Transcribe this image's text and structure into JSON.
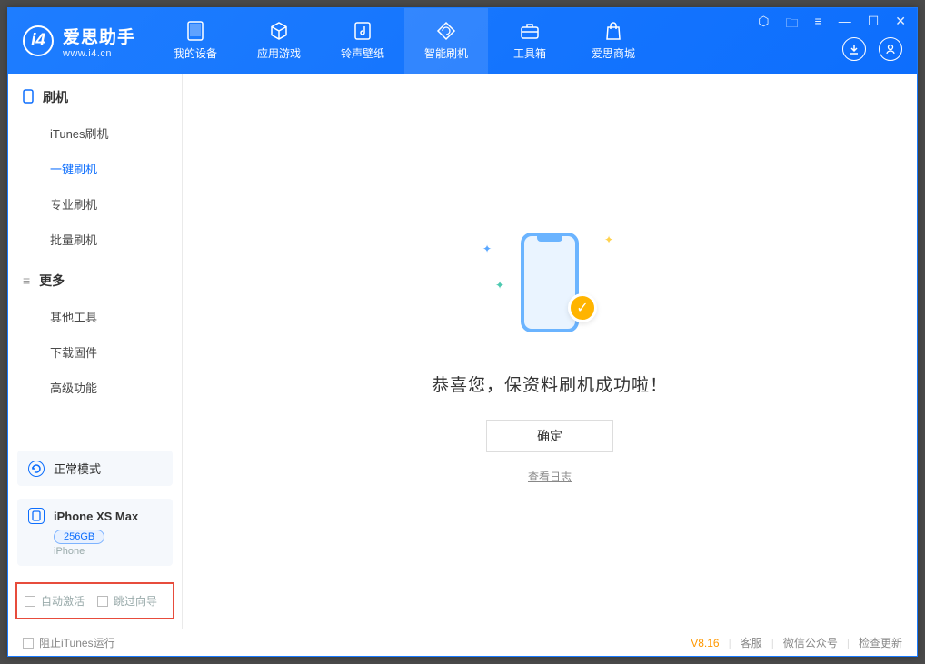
{
  "app": {
    "name": "爱思助手",
    "url": "www.i4.cn"
  },
  "nav": [
    {
      "label": "我的设备",
      "icon": "device"
    },
    {
      "label": "应用游戏",
      "icon": "cube"
    },
    {
      "label": "铃声壁纸",
      "icon": "music"
    },
    {
      "label": "智能刷机",
      "icon": "refresh",
      "active": true
    },
    {
      "label": "工具箱",
      "icon": "toolbox"
    },
    {
      "label": "爱思商城",
      "icon": "bag"
    }
  ],
  "sidebar": {
    "section1": {
      "title": "刷机"
    },
    "items1": [
      {
        "label": "iTunes刷机"
      },
      {
        "label": "一键刷机",
        "active": true
      },
      {
        "label": "专业刷机"
      },
      {
        "label": "批量刷机"
      }
    ],
    "section2": {
      "title": "更多"
    },
    "items2": [
      {
        "label": "其他工具"
      },
      {
        "label": "下载固件"
      },
      {
        "label": "高级功能"
      }
    ],
    "mode_card": {
      "label": "正常模式"
    },
    "device": {
      "name": "iPhone XS Max",
      "capacity": "256GB",
      "type": "iPhone"
    },
    "checkboxes": {
      "auto_activate": "自动激活",
      "skip_guide": "跳过向导"
    }
  },
  "main": {
    "success_message": "恭喜您，保资料刷机成功啦！",
    "ok_button": "确定",
    "view_log": "查看日志"
  },
  "footer": {
    "block_itunes": "阻止iTunes运行",
    "version": "V8.16",
    "links": {
      "service": "客服",
      "wechat": "微信公众号",
      "update": "检查更新"
    }
  }
}
